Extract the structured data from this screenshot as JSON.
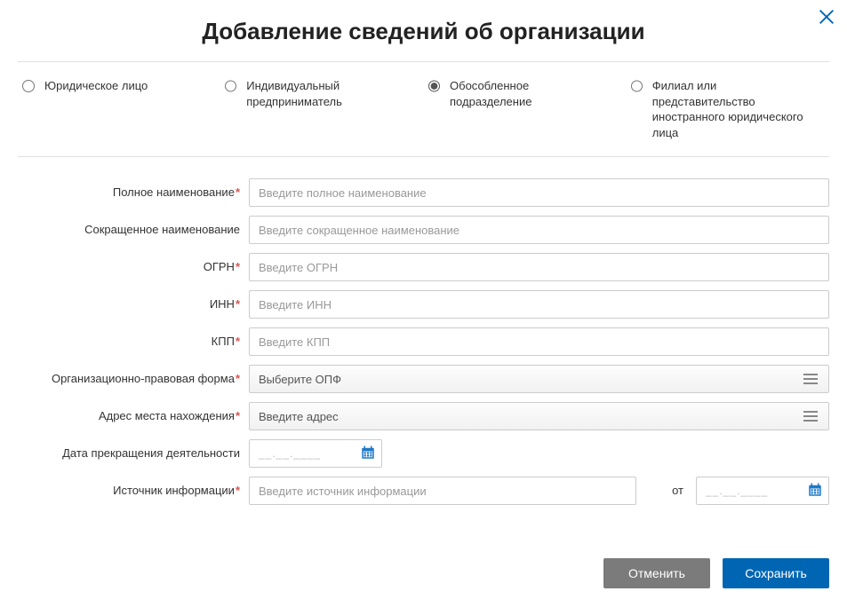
{
  "title": "Добавление сведений об организации",
  "radios": {
    "legal": "Юридическое лицо",
    "ip": "Индивидуальный предприниматель",
    "unit": "Обособленное подразделение",
    "foreign": "Филиал или представительство иностранного юридического лица",
    "selected": "unit"
  },
  "labels": {
    "full_name": "Полное наименование",
    "short_name": "Сокращенное наименование",
    "ogrn": "ОГРН",
    "inn": "ИНН",
    "kpp": "КПП",
    "opf": "Организационно-правовая форма",
    "address": "Адрес места нахождения",
    "end_date": "Дата прекращения деятельности",
    "source": "Источник информации",
    "ot": "от"
  },
  "placeholders": {
    "full_name": "Введите полное наименование",
    "short_name": "Введите сокращенное наименование",
    "ogrn": "Введите ОГРН",
    "inn": "Введите ИНН",
    "kpp": "Введите КПП",
    "opf": "Выберите ОПФ",
    "address": "Введите адрес",
    "source": "Введите источник информации",
    "date_mask": "__.__.____"
  },
  "buttons": {
    "cancel": "Отменить",
    "save": "Сохранить"
  }
}
